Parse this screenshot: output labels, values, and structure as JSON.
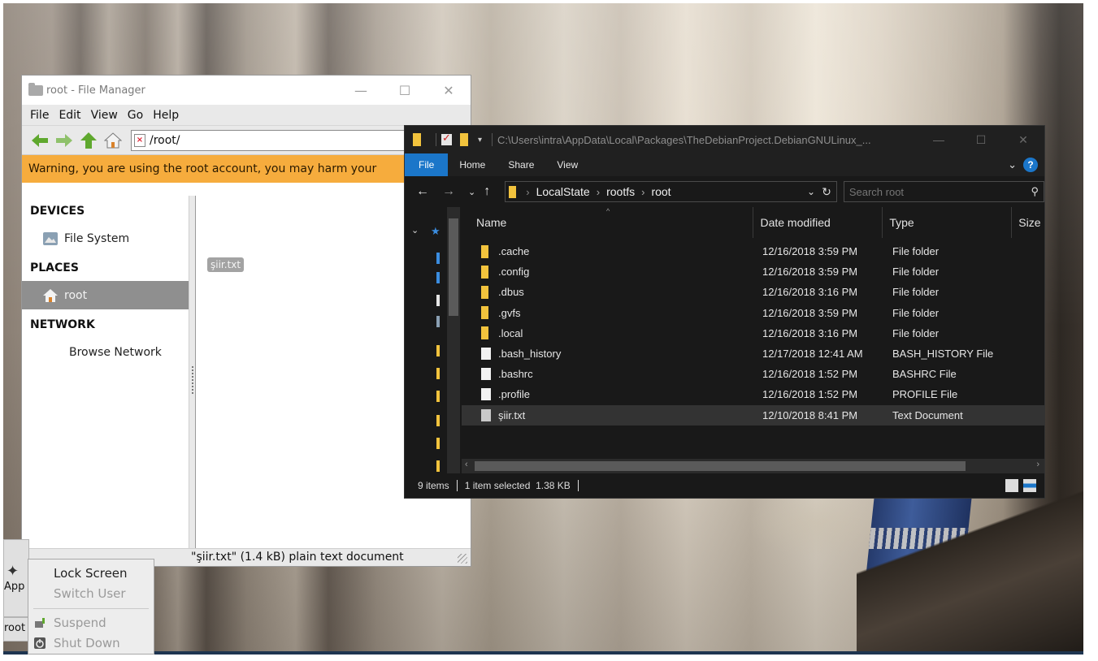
{
  "file_manager": {
    "title": "root - File Manager",
    "menu": [
      "File",
      "Edit",
      "View",
      "Go",
      "Help"
    ],
    "location": "/root/",
    "warning": "Warning, you are using the root account, you may harm your",
    "sidebar": {
      "devices_heading": "DEVICES",
      "file_system": "File System",
      "places_heading": "PLACES",
      "root": "root",
      "network_heading": "NETWORK",
      "browse_network": "Browse Network"
    },
    "file_item": "şiir.txt",
    "status": "\"şiir.txt\" (1.4 kB) plain text document"
  },
  "explorer": {
    "title_path": "C:\\Users\\intra\\AppData\\Local\\Packages\\TheDebianProject.DebianGNULinux_...",
    "ribbon_tabs": [
      "File",
      "Home",
      "Share",
      "View"
    ],
    "breadcrumb": [
      "LocalState",
      "rootfs",
      "root"
    ],
    "search_placeholder": "Search root",
    "columns": [
      "Name",
      "Date modified",
      "Type",
      "Size"
    ],
    "rows": [
      {
        "name": ".cache",
        "date": "12/16/2018 3:59 PM",
        "type": "File folder",
        "icon": "folder"
      },
      {
        "name": ".config",
        "date": "12/16/2018 3:59 PM",
        "type": "File folder",
        "icon": "folder"
      },
      {
        "name": ".dbus",
        "date": "12/16/2018 3:16 PM",
        "type": "File folder",
        "icon": "folder"
      },
      {
        "name": ".gvfs",
        "date": "12/16/2018 3:59 PM",
        "type": "File folder",
        "icon": "folder"
      },
      {
        "name": ".local",
        "date": "12/16/2018 3:16 PM",
        "type": "File folder",
        "icon": "folder"
      },
      {
        "name": ".bash_history",
        "date": "12/17/2018 12:41 AM",
        "type": "BASH_HISTORY File",
        "icon": "file"
      },
      {
        "name": ".bashrc",
        "date": "12/16/2018 1:52 PM",
        "type": "BASHRC File",
        "icon": "file"
      },
      {
        "name": ".profile",
        "date": "12/16/2018 1:52 PM",
        "type": "PROFILE File",
        "icon": "file"
      },
      {
        "name": "şiir.txt",
        "date": "12/10/2018 8:41 PM",
        "type": "Text Document",
        "icon": "text"
      }
    ],
    "status_items": "9 items",
    "status_selected": "1 item selected  1.38 KB"
  },
  "panel": {
    "app_label": "App",
    "root_label": "root"
  },
  "action_menu": {
    "lock_screen": "Lock Screen",
    "switch_user": "Switch User",
    "suspend": "Suspend",
    "shut_down": "Shut Down"
  },
  "colors": {
    "warning_bg": "#f6ac3d",
    "explorer_accent": "#1b76c9",
    "folder_yellow": "#f2c33d"
  }
}
